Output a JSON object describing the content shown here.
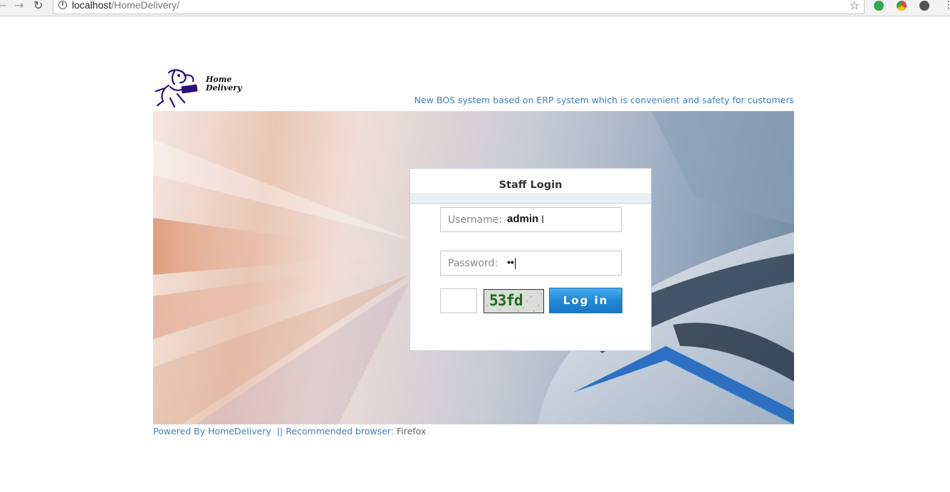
{
  "browser": {
    "url_host": "localhost",
    "url_path": "/HomeDelivery/",
    "back_icon": "back-arrow-icon",
    "forward_icon": "forward-arrow-icon",
    "reload_icon": "reload-icon"
  },
  "header": {
    "logo_line1": "Home",
    "logo_line2": "Delivery",
    "tagline": "New BOS system based on ERP system which is convenient and safety for customers"
  },
  "login": {
    "title": "Staff Login",
    "username_label": "Username:",
    "username_value": "admin",
    "password_label": "Password:",
    "password_value": "••",
    "captcha_value": "",
    "captcha_text": "53fd",
    "button_label": "Log in"
  },
  "footer": {
    "powered": "Powered By HomeDelivery",
    "recommended": "  || Recommended browser: ",
    "browser": "Firefox"
  },
  "colors": {
    "link_blue": "#3f7fbf",
    "button_blue": "#2289d6",
    "captcha_green": "#1c6b1c"
  }
}
